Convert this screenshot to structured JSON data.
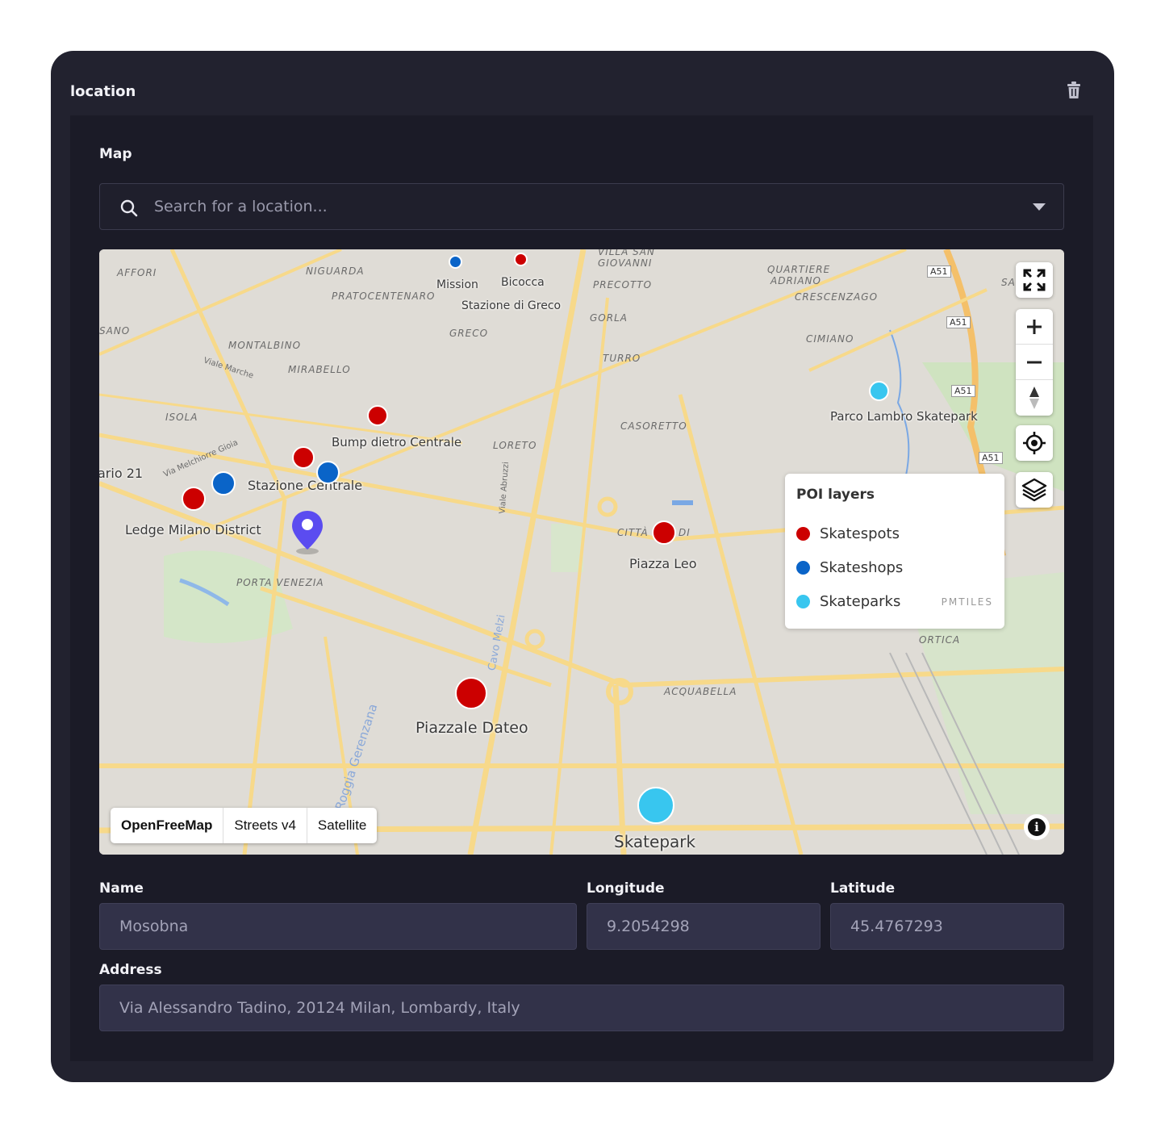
{
  "card": {
    "title": "location"
  },
  "map_section": {
    "label": "Map",
    "search_placeholder": "Search for a location..."
  },
  "map": {
    "area_labels": [
      "AFFORI",
      "NIGUARDA",
      "VILLA SAN",
      "GIOVANNI",
      "QUARTIERE",
      "ADRIANO",
      "PRECOTTO",
      "PRATOCENTENARO",
      "CRESCENZAGO",
      "GORLA",
      "GRECO",
      "MONTALBINO",
      "MIRABELLO",
      "TURRO",
      "CIMIANO",
      "ISOLA",
      "CASORETTO",
      "LORETO",
      "CITTÀ",
      "DI",
      "PORTA VENEZIA",
      "ORTICA",
      "ACQUABELLA",
      "SANO",
      "SA"
    ],
    "road_labels": [
      "A51",
      "A51",
      "A51",
      "A51"
    ],
    "pois": [
      {
        "name": "Mission",
        "type": "Skateshops"
      },
      {
        "name": "Bicocca",
        "type": "Skatespots"
      },
      {
        "name": "Stazione di Greco",
        "type": ""
      },
      {
        "name": "Parco Lambro Skatepark",
        "type": "Skateparks"
      },
      {
        "name": "Bump dietro Centrale",
        "type": "Skatespots"
      },
      {
        "name": "Stazione Centrale",
        "type": "Skatespots"
      },
      {
        "name": "ario 21",
        "type": ""
      },
      {
        "name": "Ledge Milano District",
        "type": "Skatespots"
      },
      {
        "name": "Piazza Leo",
        "type": "Skatespots"
      },
      {
        "name": "Piazzale Dateo",
        "type": "Skatespots"
      },
      {
        "name": "Skatepark",
        "type": "Skateparks"
      }
    ],
    "street_labels": [
      "Viale Abruzzi",
      "Cavo Melzi",
      "Roggia Gerenzana",
      "Viale Marche",
      "Via Melchiorre Gioia"
    ],
    "legend": {
      "title": "POI layers",
      "items": [
        {
          "label": "Skatespots",
          "color": "#cc0000"
        },
        {
          "label": "Skateshops",
          "color": "#0a64c8"
        },
        {
          "label": "Skateparks",
          "color": "#38c6ef"
        }
      ],
      "source": "PMTILES"
    },
    "style_buttons": [
      "OpenFreeMap",
      "Streets v4",
      "Satellite"
    ],
    "active_style": "OpenFreeMap",
    "controls": [
      "fullscreen-icon",
      "zoom-in-icon",
      "zoom-out-icon",
      "compass-icon",
      "geolocate-icon",
      "layers-icon",
      "info-icon"
    ],
    "marker_color": "#5b4cf0"
  },
  "fields": {
    "name": {
      "label": "Name",
      "value": "Mosobna"
    },
    "longitude": {
      "label": "Longitude",
      "value": "9.2054298"
    },
    "latitude": {
      "label": "Latitude",
      "value": "45.4767293"
    },
    "address": {
      "label": "Address",
      "value": "Via Alessandro Tadino, 20124 Milan, Lombardy, Italy"
    }
  }
}
